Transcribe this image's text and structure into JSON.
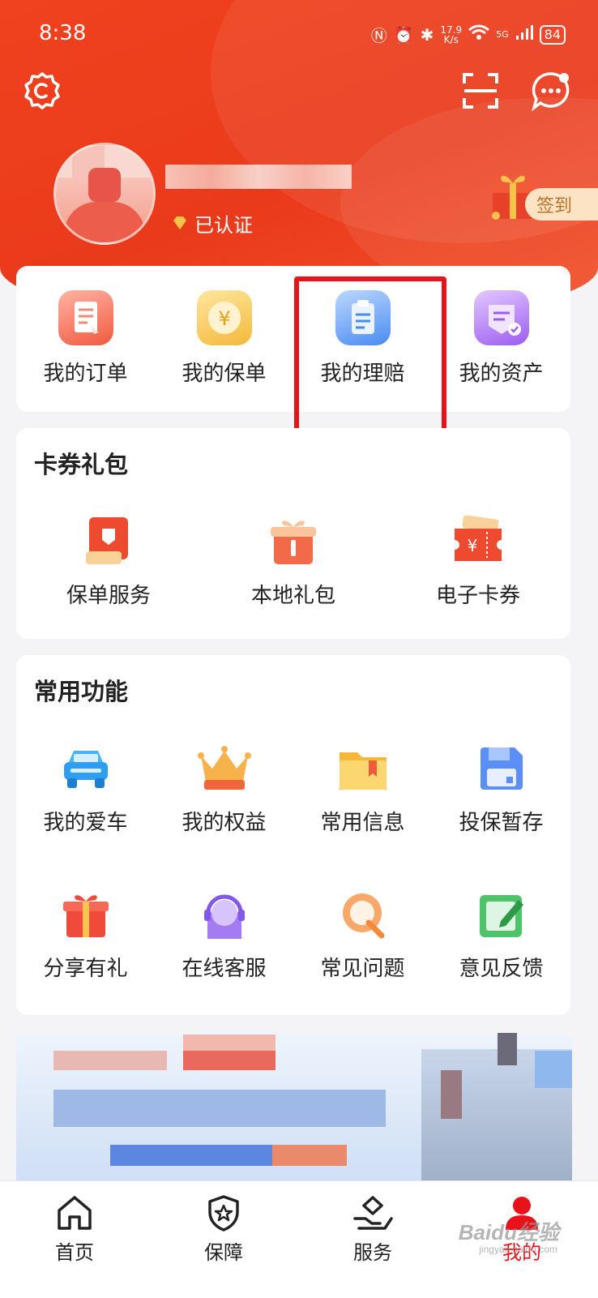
{
  "status_bar": {
    "time": "8:38",
    "speed_value": "17.9",
    "speed_unit": "K/s",
    "network": "5G",
    "battery": "84"
  },
  "profile": {
    "verified_label": "已认证",
    "signin_label": "签到"
  },
  "quick_actions": [
    {
      "label": "我的订单",
      "icon": "order-icon"
    },
    {
      "label": "我的保单",
      "icon": "policy-icon"
    },
    {
      "label": "我的理赔",
      "icon": "claims-icon"
    },
    {
      "label": "我的资产",
      "icon": "assets-icon"
    }
  ],
  "coupons": {
    "title": "卡券礼包",
    "items": [
      {
        "label": "保单服务",
        "icon": "policy-service-icon"
      },
      {
        "label": "本地礼包",
        "icon": "gift-icon"
      },
      {
        "label": "电子卡券",
        "icon": "ticket-icon"
      }
    ]
  },
  "functions": {
    "title": "常用功能",
    "items": [
      {
        "label": "我的爱车",
        "icon": "car-icon"
      },
      {
        "label": "我的权益",
        "icon": "crown-icon"
      },
      {
        "label": "常用信息",
        "icon": "folder-icon"
      },
      {
        "label": "投保暂存",
        "icon": "save-icon"
      },
      {
        "label": "分享有礼",
        "icon": "share-gift-icon"
      },
      {
        "label": "在线客服",
        "icon": "customer-service-icon"
      },
      {
        "label": "常见问题",
        "icon": "faq-icon"
      },
      {
        "label": "意见反馈",
        "icon": "feedback-icon"
      }
    ]
  },
  "tabbar": [
    {
      "label": "首页",
      "icon": "home-icon",
      "active": false
    },
    {
      "label": "保障",
      "icon": "shield-icon",
      "active": false
    },
    {
      "label": "服务",
      "icon": "service-icon",
      "active": false
    },
    {
      "label": "我的",
      "icon": "user-icon",
      "active": true
    }
  ],
  "watermark": {
    "text": "Baidu经验",
    "sub": "jingyan.baidu.com"
  },
  "colors": {
    "brand": "#ea3a1c",
    "highlight": "#e8121b"
  }
}
